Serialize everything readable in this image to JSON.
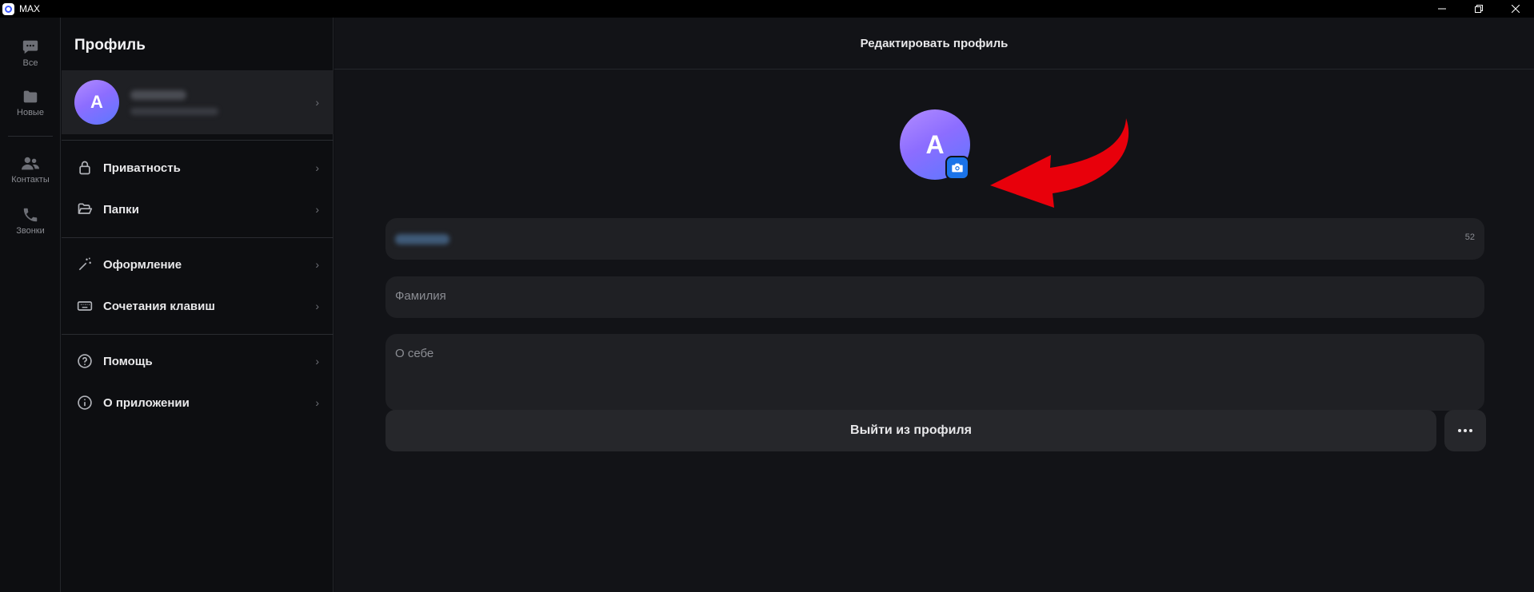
{
  "window": {
    "title": "MAX"
  },
  "rail": {
    "items": [
      {
        "label": "Все",
        "icon": "chat-icon"
      },
      {
        "label": "Новые",
        "icon": "folder-icon"
      },
      {
        "label": "Контакты",
        "icon": "contacts-icon"
      },
      {
        "label": "Звонки",
        "icon": "phone-icon"
      }
    ]
  },
  "panel": {
    "title": "Профиль",
    "profile": {
      "initial": "A"
    },
    "menu": [
      {
        "label": "Приватность",
        "icon": "lock-icon"
      },
      {
        "label": "Папки",
        "icon": "folder-open-icon"
      },
      {
        "label": "Оформление",
        "icon": "magic-wand-icon"
      },
      {
        "label": "Сочетания клавиш",
        "icon": "keyboard-icon"
      },
      {
        "label": "Помощь",
        "icon": "help-circle-icon"
      },
      {
        "label": "О приложении",
        "icon": "info-circle-icon"
      }
    ]
  },
  "main": {
    "header_title": "Редактировать профиль",
    "avatar_initial": "A",
    "first_name_counter": "52",
    "last_name_placeholder": "Фамилия",
    "about_placeholder": "О себе",
    "logout_label": "Выйти из профиля"
  },
  "colors": {
    "accent": "#1a73e8",
    "annotation_arrow": "#e8000b"
  }
}
